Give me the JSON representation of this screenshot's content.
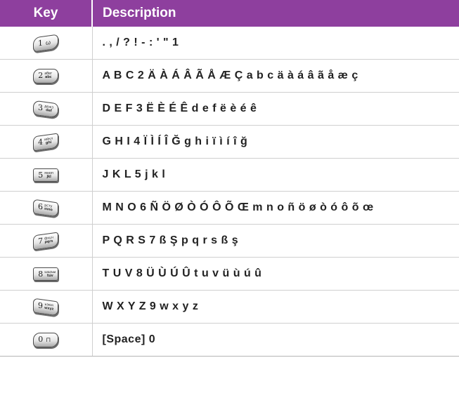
{
  "table": {
    "headers": {
      "key": "Key",
      "description": "Description"
    },
    "header_color": "#8e3f9e",
    "rows": [
      {
        "key_icon": "key-1-icon",
        "key_digit": "1",
        "key_sub_top": "",
        "key_sub_bottom": "",
        "key_glyph": "ω",
        "description": ". , / ? ! - : ' \" 1"
      },
      {
        "key_icon": "key-2-icon",
        "key_digit": "2",
        "key_sub_top": "абвг",
        "key_sub_bottom": "abc",
        "key_glyph": "",
        "description": "A B C 2 Ä À Á Â Ã Å Æ Ç a b c ä à á â ã å æ ç"
      },
      {
        "key_icon": "key-3-icon",
        "key_digit": "3",
        "key_sub_top": "дежз",
        "key_sub_bottom": "def",
        "key_glyph": "",
        "description": "D E F 3 Ë È É Ê d e f ë è é ê"
      },
      {
        "key_icon": "key-4-icon",
        "key_digit": "4",
        "key_sub_top": "ийкл",
        "key_sub_bottom": "ghi",
        "key_glyph": "",
        "description": "G H I 4 Ï Ì Í Î Ğ g h i ï ì í î ğ"
      },
      {
        "key_icon": "key-5-icon",
        "key_digit": "5",
        "key_sub_top": "мноп",
        "key_sub_bottom": "jkl",
        "key_glyph": "",
        "description": "J K L 5 j k l"
      },
      {
        "key_icon": "key-6-icon",
        "key_digit": "6",
        "key_sub_top": "рсту",
        "key_sub_bottom": "mno",
        "key_glyph": "",
        "description": "M N O 6 Ñ Ö Ø Ò Ó Ô Õ Œ m n o ñ ö ø ò ó ô õ œ"
      },
      {
        "key_icon": "key-7-icon",
        "key_digit": "7",
        "key_sub_top": "фхцч",
        "key_sub_bottom": "pqrs",
        "key_glyph": "",
        "description": "P Q R S 7 ß Ş p q r s ß ş"
      },
      {
        "key_icon": "key-8-icon",
        "key_digit": "8",
        "key_sub_top": "шщъы",
        "key_sub_bottom": "tuv",
        "key_glyph": "",
        "description": "T U V 8 Ü Ù Ú Û t u v ü ù ú û"
      },
      {
        "key_icon": "key-9-icon",
        "key_digit": "9",
        "key_sub_top": "ьэюя",
        "key_sub_bottom": "wxyz",
        "key_glyph": "",
        "description": "W X Y Z 9 w x y z"
      },
      {
        "key_icon": "key-0-icon",
        "key_digit": "0",
        "key_sub_top": "",
        "key_sub_bottom": "",
        "key_glyph": "⊓",
        "description": "[Space] 0"
      }
    ]
  }
}
